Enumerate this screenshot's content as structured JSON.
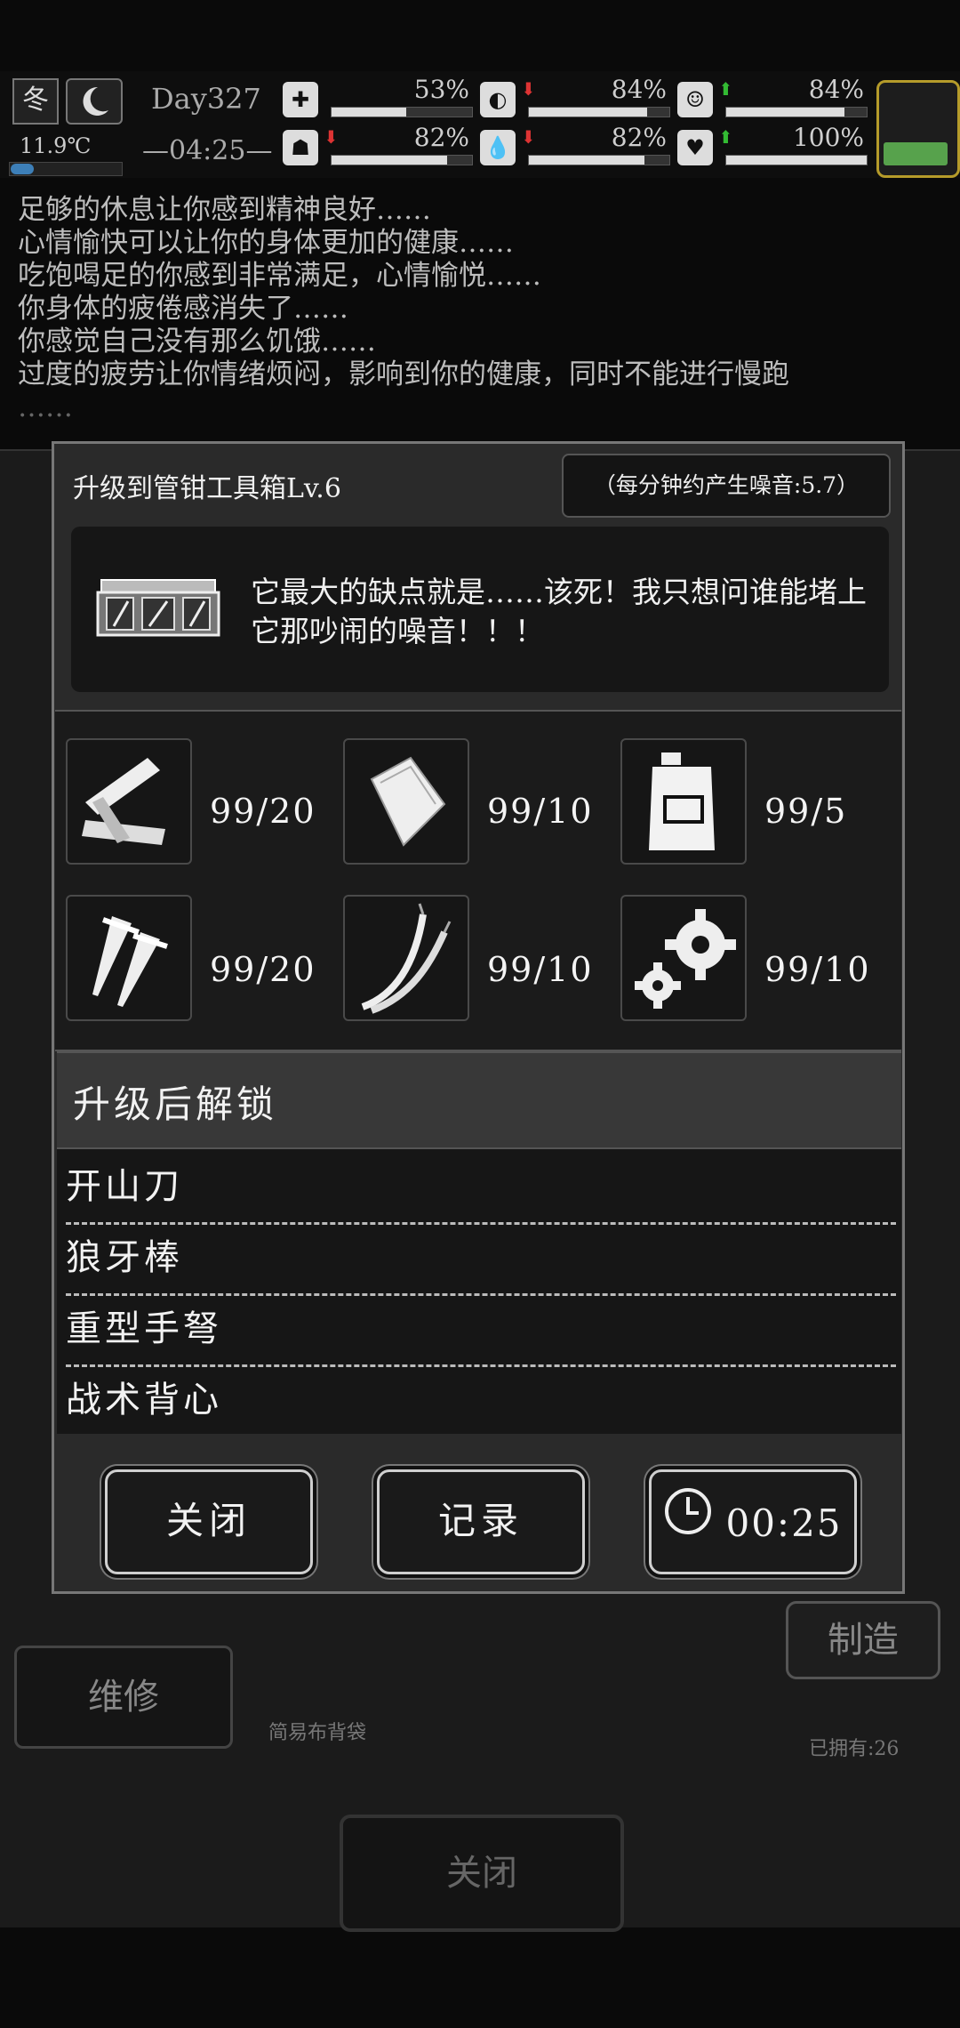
{
  "status": {
    "season": "冬",
    "temperature": "11.9℃",
    "day": "Day327",
    "time": "—04:25—",
    "stats": [
      {
        "icon": "medkit-icon",
        "value": "53%",
        "fill": 0.53,
        "trend": ""
      },
      {
        "icon": "stomach-icon",
        "value": "84%",
        "fill": 0.84,
        "trend": "down"
      },
      {
        "icon": "mood-icon",
        "value": "84%",
        "fill": 0.84,
        "trend": "up"
      },
      {
        "icon": "fatigue-icon",
        "value": "82%",
        "fill": 0.82,
        "trend": "down"
      },
      {
        "icon": "water-drop-icon",
        "value": "82%",
        "fill": 0.82,
        "trend": "down"
      },
      {
        "icon": "heart-icon",
        "value": "100%",
        "fill": 1.0,
        "trend": "up"
      }
    ],
    "accent_gold": "#b59b2a",
    "accent_green": "#57a24c"
  },
  "log": [
    "足够的休息让你感到精神良好……",
    "心情愉快可以让你的身体更加的健康……",
    "吃饱喝足的你感到非常满足，心情愉悦……",
    "你身体的疲倦感消失了……",
    "你感觉自己没有那么饥饿……",
    "过度的疲劳让你情绪烦闷，影响到你的健康，同时不能进行慢跑",
    "……"
  ],
  "background": {
    "repair_label": "维修",
    "make_label": "制造",
    "item_name": "简易布背袋",
    "owned": "已拥有:26",
    "close_label": "关闭"
  },
  "dialog": {
    "title": "升级到管钳工具箱Lv.6",
    "noise": "（每分钟约产生噪音:5.7）",
    "description": "它最大的缺点就是……该死！我只想问谁能堵上它那吵闹的噪音！！！",
    "materials": [
      {
        "icon": "wood-planks-icon",
        "count": "99/20"
      },
      {
        "icon": "cloth-sheet-icon",
        "count": "99/10"
      },
      {
        "icon": "fuel-can-icon",
        "count": "99/5"
      },
      {
        "icon": "screws-icon",
        "count": "99/20"
      },
      {
        "icon": "wires-icon",
        "count": "99/10"
      },
      {
        "icon": "gears-icon",
        "count": "99/10"
      }
    ],
    "unlock_title": "升级后解锁",
    "unlocks": [
      "开山刀",
      "狼牙棒",
      "重型手弩",
      "战术背心"
    ],
    "buttons": {
      "close": "关闭",
      "record": "记录",
      "timer": "00:25"
    }
  }
}
